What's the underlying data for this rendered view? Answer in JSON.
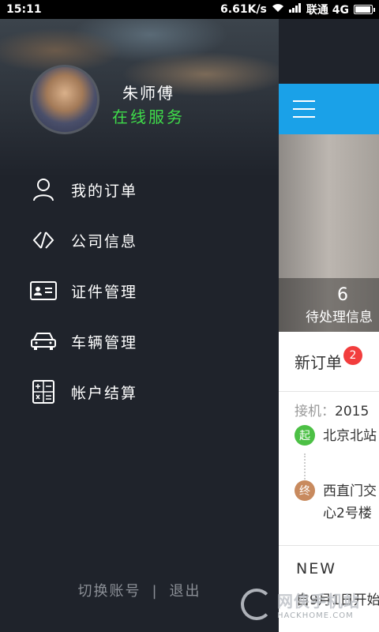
{
  "status_bar": {
    "time": "15:11",
    "network_speed": "6.61K/s",
    "carrier": "联通 4G",
    "battery_level": 0.85
  },
  "drawer": {
    "user": {
      "name": "朱师傅",
      "status": "在线服务"
    },
    "menu": [
      {
        "label": "我的订单",
        "icon": "user-icon"
      },
      {
        "label": "公司信息",
        "icon": "diamond-icon"
      },
      {
        "label": "证件管理",
        "icon": "id-card-icon"
      },
      {
        "label": "车辆管理",
        "icon": "car-icon"
      },
      {
        "label": "帐户结算",
        "icon": "calculator-icon"
      }
    ],
    "footer": {
      "switch_account": "切换账号",
      "separator": "|",
      "logout": "退出"
    }
  },
  "main": {
    "pending_count": "6",
    "pending_label": "待处理信息",
    "new_order_title": "新订单",
    "new_order_badge": "2",
    "pickup_label": "接机：",
    "pickup_value": "2015",
    "origin_marker": "起",
    "origin": "北京北站",
    "destination_marker": "终",
    "destination_line1": "西直门交",
    "destination_line2": "心2号楼",
    "news_title": "NEW",
    "news_text": "自9月1日开始"
  },
  "watermark": {
    "title": "网侠手机站",
    "url": "HACKHOME.COM"
  },
  "colors": {
    "accent": "#1aa1e8",
    "online": "#3fdc4a",
    "badge": "#f23d3d",
    "drawer_bg": "#1f232b"
  }
}
